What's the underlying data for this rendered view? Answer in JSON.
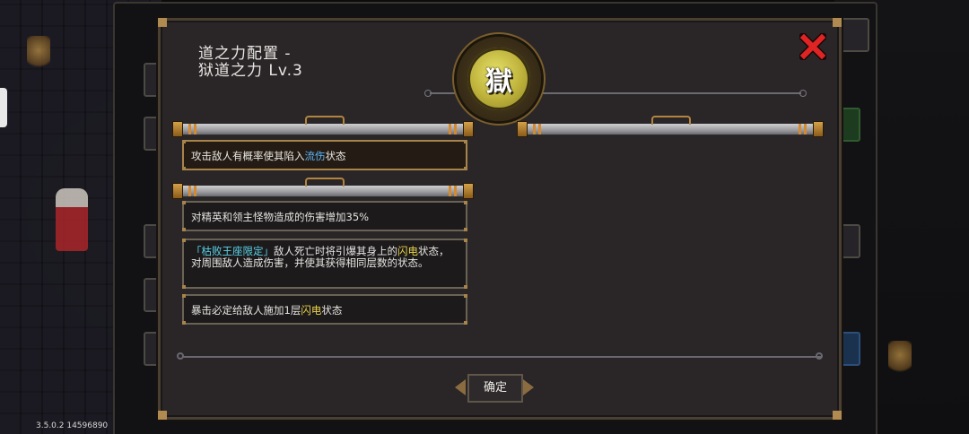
{
  "dialog": {
    "title_line1": "道之力配置 -",
    "title_line2": "狱道之力 Lv.3",
    "emblem_glyph": "獄",
    "close_icon": "red-x-icon",
    "confirm_label": "确定"
  },
  "effects": {
    "first": {
      "prefix": "攻击敌人有概率使其陷入",
      "keyword": "流伤",
      "suffix": "状态"
    },
    "second": {
      "text": "对精英和领主怪物造成的伤害增加35%"
    },
    "third": {
      "tag": "「枯败王座限定」",
      "part1": "敌人死亡时将引爆其身上的",
      "keyword": "闪电",
      "part2": "状态，对周围敌人造成伤害，并使其获得相同层数的状态。"
    },
    "fourth": {
      "prefix": "暴击必定给敌人施加1层",
      "keyword": "闪电",
      "suffix": "状态"
    }
  },
  "footer": {
    "version": "3.5.0.2 14596890"
  },
  "colors": {
    "keyword_blue": "#5cb8ff",
    "keyword_yellow": "#e8d24a",
    "keyword_cyan": "#59d4e8",
    "close_red": "#e02424",
    "emblem_gold": "#bfb33c"
  }
}
